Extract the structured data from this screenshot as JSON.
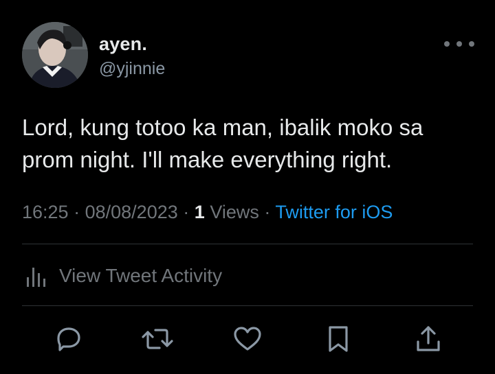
{
  "author": {
    "display_name": "ayen.",
    "handle": "@yjinnie"
  },
  "tweet": {
    "text": "Lord, kung totoo ka man, ibalik moko sa prom night. I'll make everything right."
  },
  "meta": {
    "time": "16:25",
    "date": "08/08/2023",
    "views_count": "1",
    "views_label": "Views",
    "source": "Twitter for iOS",
    "separator": "·"
  },
  "activity": {
    "label": "View Tweet Activity"
  },
  "actions": {
    "icons": [
      "reply-icon",
      "retweet-icon",
      "like-icon",
      "bookmark-icon",
      "share-icon"
    ]
  },
  "colors": {
    "background": "#000000",
    "text": "#e7e9ea",
    "muted": "#71767b",
    "link": "#1d9bf0",
    "divider": "#2f3336"
  }
}
